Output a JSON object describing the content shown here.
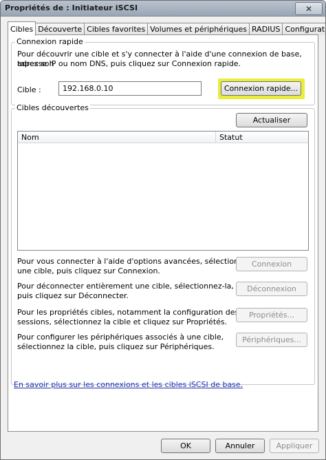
{
  "window": {
    "title": "Propriétés de : Initiateur iSCSI",
    "close_glyph": "✕"
  },
  "tabs": [
    {
      "label": "Cibles",
      "active": true
    },
    {
      "label": "Découverte"
    },
    {
      "label": "Cibles favorites"
    },
    {
      "label": "Volumes et périphériques"
    },
    {
      "label": "RADIUS"
    },
    {
      "label": "Configuration"
    }
  ],
  "quick_connect": {
    "group_label": "Connexion rapide",
    "description_line1": "Pour découvrir une cible et s'y connecter à l'aide d'une connexion de base, tapez son",
    "description_line2": "adresse IP ou nom DNS, puis cliquez sur Connexion rapide.",
    "target_label": "Cible :",
    "target_value": "192.168.0.10",
    "button_label": "Connexion rapide...",
    "highlight_color": "#e9ee3a"
  },
  "discovered": {
    "group_label": "Cibles découvertes",
    "refresh_label": "Actualiser",
    "columns": [
      "Nom",
      "Statut"
    ],
    "rows": []
  },
  "actions": [
    {
      "line1": "Pour vous connecter à l'aide d'options avancées, sélectionnez",
      "line2": "une cible, puis cliquez sur Connexion.",
      "button": "Connexion"
    },
    {
      "line1": "Pour déconnecter entièrement une cible, sélectionnez-la,",
      "line2": "puis cliquez sur Déconnecter.",
      "button": "Déconnexion"
    },
    {
      "line1": "Pour les propriétés cibles, notamment la configuration des",
      "line2": "sessions, sélectionnez la cible et cliquez sur Propriétés.",
      "button": "Propriétés..."
    },
    {
      "line1": "Pour configurer les périphériques associés à une cible,",
      "line2": "sélectionnez la cible, puis cliquez sur Périphériques.",
      "button": "Périphériques..."
    }
  ],
  "help_link": "En savoir plus sur les connexions et les cibles iSCSI de base.",
  "footer": {
    "ok": "OK",
    "cancel": "Annuler",
    "apply": "Appliquer"
  }
}
